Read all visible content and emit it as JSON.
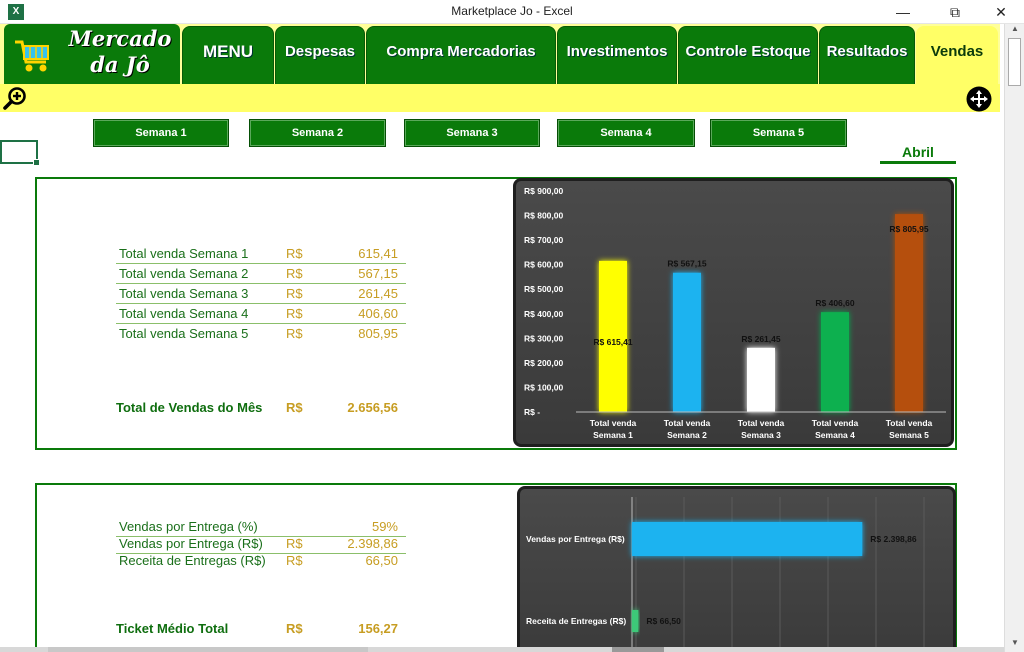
{
  "window": {
    "title": "Marketplace Jo - Excel",
    "app_icon": "excel-icon",
    "controls": [
      "minimize",
      "restore",
      "close"
    ]
  },
  "brand": {
    "line1": "Mercado",
    "line2": "da Jô",
    "icon": "shopping-cart-icon"
  },
  "nav": {
    "tabs": [
      {
        "label": "MENU",
        "active": false
      },
      {
        "label": "Despesas",
        "active": false
      },
      {
        "label": "Compra Mercadorias",
        "active": false
      },
      {
        "label": "Investimentos",
        "active": false
      },
      {
        "label": "Controle Estoque",
        "active": false
      },
      {
        "label": "Resultados",
        "active": false
      },
      {
        "label": "Vendas",
        "active": true
      }
    ],
    "zoom_icon": "zoom-in-icon",
    "move_icon": "move-arrows-icon"
  },
  "weeks": [
    "Semana 1",
    "Semana 2",
    "Semana 3",
    "Semana 4",
    "Semana 5"
  ],
  "month": "Abril",
  "sales_panel": {
    "rows": [
      {
        "label": "Total venda Semana 1",
        "currency": "R$",
        "value": "615,41"
      },
      {
        "label": "Total venda Semana 2",
        "currency": "R$",
        "value": "567,15"
      },
      {
        "label": "Total venda Semana 3",
        "currency": "R$",
        "value": "261,45"
      },
      {
        "label": "Total venda Semana 4",
        "currency": "R$",
        "value": "406,60"
      },
      {
        "label": "Total venda Semana 5",
        "currency": "R$",
        "value": "805,95"
      }
    ],
    "total": {
      "label": "Total de Vendas do Mês",
      "currency": "R$",
      "value": "2.656,56"
    }
  },
  "delivery_panel": {
    "rows": [
      {
        "label": "Vendas por Entrega (%)",
        "currency": "",
        "value": "59%"
      },
      {
        "label": "Vendas por Entrega (R$)",
        "currency": "R$",
        "value": "2.398,86"
      },
      {
        "label": "Receita de Entregas (R$)",
        "currency": "R$",
        "value": "66,50"
      }
    ],
    "total": {
      "label": "Ticket Médio Total",
      "currency": "R$",
      "value": "156,27"
    }
  },
  "chart_data": [
    {
      "type": "bar",
      "categories": [
        "Total venda Semana 1",
        "Total venda Semana 2",
        "Total venda Semana 3",
        "Total venda Semana 4",
        "Total venda Semana 5"
      ],
      "category_lines": [
        [
          "Total venda",
          "Semana 1"
        ],
        [
          "Total venda",
          "Semana 2"
        ],
        [
          "Total venda",
          "Semana 3"
        ],
        [
          "Total venda",
          "Semana 4"
        ],
        [
          "Total venda",
          "Semana 5"
        ]
      ],
      "values": [
        615.41,
        567.15,
        261.45,
        406.6,
        805.95
      ],
      "data_labels": [
        "R$ 615,41",
        "R$ 567,15",
        "R$ 261,45",
        "R$ 406,60",
        "R$ 805,95"
      ],
      "colors": [
        "#ffff00",
        "#1fb3f0",
        "#ffffff",
        "#10b050",
        "#b5500e"
      ],
      "yticks": [
        "R$ -",
        "R$ 100,00",
        "R$ 200,00",
        "R$ 300,00",
        "R$ 400,00",
        "R$ 500,00",
        "R$ 600,00",
        "R$ 700,00",
        "R$ 800,00",
        "R$ 900,00"
      ],
      "ylim": [
        0,
        900
      ],
      "grid": false,
      "title": "",
      "xlabel": "",
      "ylabel": ""
    },
    {
      "type": "bar",
      "orientation": "horizontal",
      "categories": [
        "Vendas por Entrega (R$)",
        "Receita de Entregas (R$)"
      ],
      "values": [
        2398.86,
        66.5
      ],
      "data_labels": [
        "R$ 2.398,86",
        "R$ 66,50"
      ],
      "colors": [
        "#1fb3f0",
        "#3cc878"
      ],
      "xlim": [
        0,
        3000
      ],
      "grid": true,
      "title": "",
      "xlabel": "",
      "ylabel": ""
    }
  ]
}
